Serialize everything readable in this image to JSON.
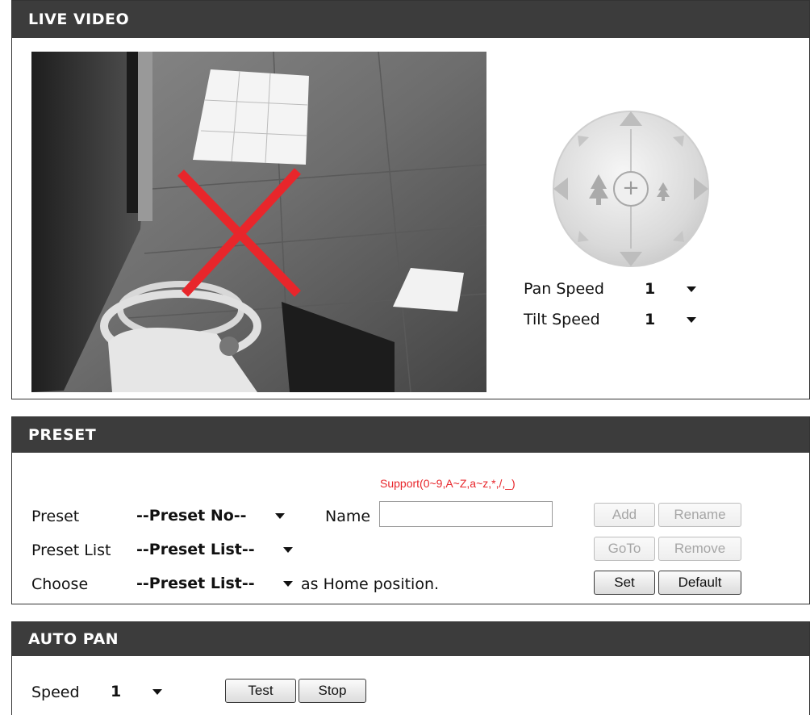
{
  "live_video": {
    "title": "LIVE VIDEO",
    "pan_speed_label": "Pan Speed",
    "pan_speed_value": "1",
    "tilt_speed_label": "Tilt Speed",
    "tilt_speed_value": "1",
    "home_symbol": "+"
  },
  "preset": {
    "title": "PRESET",
    "support_note": "Support(0~9,A~Z,a~z,*,/,_)",
    "preset_label": "Preset",
    "preset_select": "--Preset No--",
    "name_label": "Name",
    "name_value": "",
    "preset_list_label": "Preset List",
    "preset_list_select": "--Preset List--",
    "choose_label": "Choose",
    "choose_select": "--Preset List--",
    "home_text": "as Home position.",
    "buttons": {
      "add": "Add",
      "rename": "Rename",
      "goto": "GoTo",
      "remove": "Remove",
      "set": "Set",
      "default": "Default"
    }
  },
  "auto_pan": {
    "title": "AUTO PAN",
    "speed_label": "Speed",
    "speed_value": "1",
    "test_button": "Test",
    "stop_button": "Stop"
  },
  "colors": {
    "header_bg": "#3c3c3c",
    "no_signal_x": "#e8262b",
    "note_red": "#e8262b"
  }
}
